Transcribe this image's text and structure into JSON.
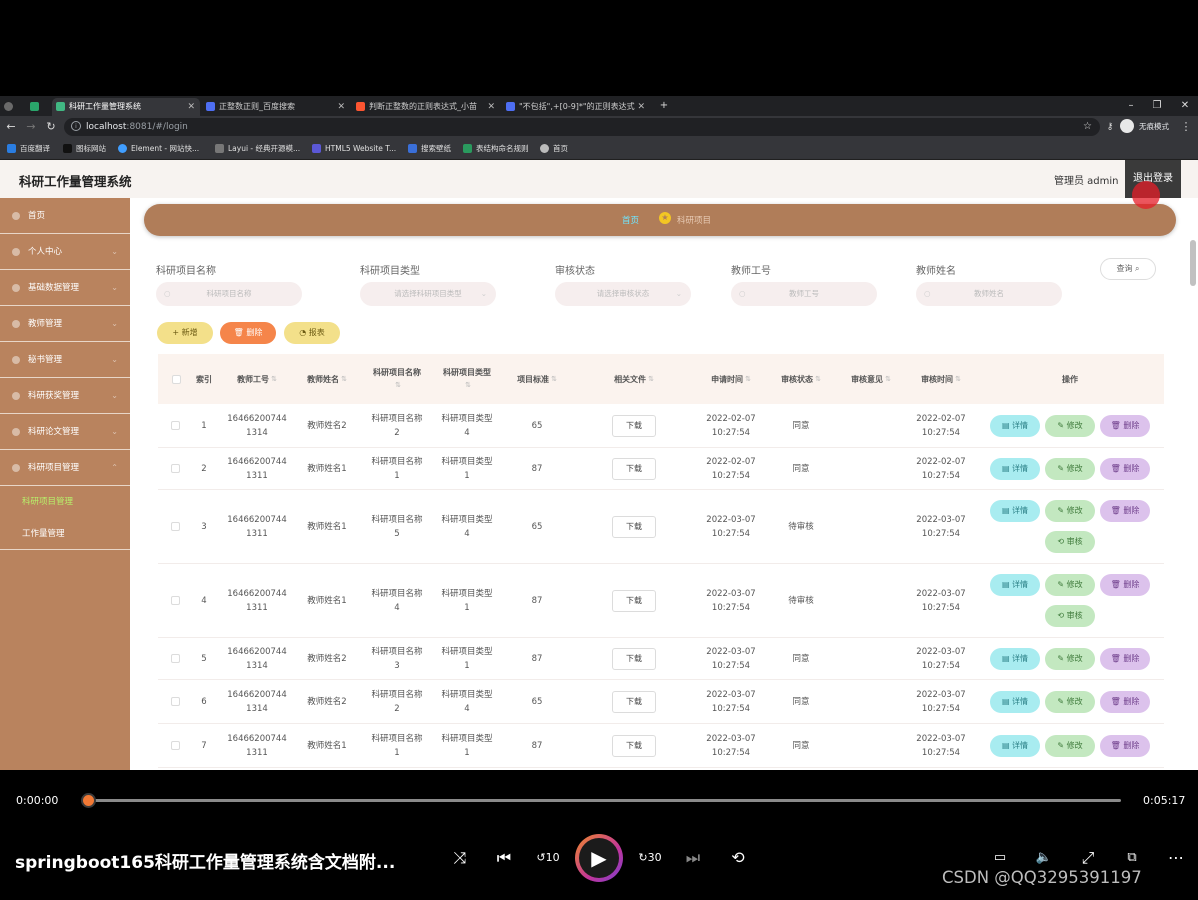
{
  "browser": {
    "tabs": [
      {
        "title": ""
      },
      {
        "title": "科研工作量管理系统"
      },
      {
        "title": "正整数正则_百度搜索"
      },
      {
        "title": "判断正整数的正则表达式_小苗"
      },
      {
        "title": "\"不包括\",+[0-9]*\"的正则表达式"
      }
    ],
    "url": {
      "host": "localhost",
      "rest": ":8081/#/login"
    },
    "profile_label": "无痕模式",
    "bookmarks": [
      "百度翻译",
      "图标网站",
      "Element - 网站快...",
      "Layui - 经典开源模...",
      "HTML5 Website T...",
      "搜索壁纸",
      "表结构命名规则",
      "首页"
    ]
  },
  "app": {
    "title": "科研工作量管理系统",
    "admin_label": "管理员 admin",
    "logout_label": "退出登录",
    "sidebar": {
      "items": [
        {
          "label": "首页"
        },
        {
          "label": "个人中心"
        },
        {
          "label": "基础数据管理"
        },
        {
          "label": "教师管理"
        },
        {
          "label": "秘书管理"
        },
        {
          "label": "科研获奖管理"
        },
        {
          "label": "科研论文管理"
        },
        {
          "label": "科研项目管理"
        }
      ],
      "sub_items": [
        {
          "label": "科研项目管理"
        },
        {
          "label": "工作量管理"
        }
      ]
    },
    "breadcrumb": {
      "home": "首页",
      "current": "科研项目"
    },
    "filters": [
      {
        "label": "科研项目名称",
        "placeholder": "科研项目名称"
      },
      {
        "label": "科研项目类型",
        "placeholder": "请选择科研项目类型"
      },
      {
        "label": "审核状态",
        "placeholder": "请选择审核状态"
      },
      {
        "label": "教师工号",
        "placeholder": "教师工号"
      },
      {
        "label": "教师姓名",
        "placeholder": "教师姓名"
      }
    ],
    "query_label": "查询",
    "actions": {
      "add": "+ 新增",
      "delete": "删除",
      "report": "报表"
    },
    "table": {
      "headers": {
        "index": "索引",
        "teacher_id": "教师工号",
        "teacher_name": "教师姓名",
        "project_name": "科研项目名称",
        "project_type": "科研项目类型",
        "standard": "项目标准",
        "file": "相关文件",
        "apply_time": "申请时间",
        "status": "审核状态",
        "opinion": "审核意见",
        "audit_time": "审核时间",
        "ops": "操作"
      },
      "download_label": "下载",
      "op_labels": {
        "detail": "详情",
        "edit": "修改",
        "delete": "删除",
        "audit": "审核"
      },
      "rows": [
        {
          "index": "1",
          "tid1": "16466200744",
          "tid2": "1314",
          "tname": "教师姓名2",
          "pname1": "科研项目名称",
          "pname2": "2",
          "ptype1": "科研项目类型",
          "ptype2": "4",
          "standard": "65",
          "apply1": "2022-02-07",
          "apply2": "10:27:54",
          "status": "同意",
          "opinion": "",
          "audit1": "2022-02-07",
          "audit2": "10:27:54"
        },
        {
          "index": "2",
          "tid1": "16466200744",
          "tid2": "1311",
          "tname": "教师姓名1",
          "pname1": "科研项目名称",
          "pname2": "1",
          "ptype1": "科研项目类型",
          "ptype2": "1",
          "standard": "87",
          "apply1": "2022-02-07",
          "apply2": "10:27:54",
          "status": "同意",
          "opinion": "",
          "audit1": "2022-02-07",
          "audit2": "10:27:54"
        },
        {
          "index": "3",
          "tid1": "16466200744",
          "tid2": "1311",
          "tname": "教师姓名1",
          "pname1": "科研项目名称",
          "pname2": "5",
          "ptype1": "科研项目类型",
          "ptype2": "4",
          "standard": "65",
          "apply1": "2022-03-07",
          "apply2": "10:27:54",
          "status": "待审核",
          "opinion": "",
          "audit1": "2022-03-07",
          "audit2": "10:27:54"
        },
        {
          "index": "4",
          "tid1": "16466200744",
          "tid2": "1311",
          "tname": "教师姓名1",
          "pname1": "科研项目名称",
          "pname2": "4",
          "ptype1": "科研项目类型",
          "ptype2": "1",
          "standard": "87",
          "apply1": "2022-03-07",
          "apply2": "10:27:54",
          "status": "待审核",
          "opinion": "",
          "audit1": "2022-03-07",
          "audit2": "10:27:54"
        },
        {
          "index": "5",
          "tid1": "16466200744",
          "tid2": "1314",
          "tname": "教师姓名2",
          "pname1": "科研项目名称",
          "pname2": "3",
          "ptype1": "科研项目类型",
          "ptype2": "1",
          "standard": "87",
          "apply1": "2022-03-07",
          "apply2": "10:27:54",
          "status": "同意",
          "opinion": "",
          "audit1": "2022-03-07",
          "audit2": "10:27:54"
        },
        {
          "index": "6",
          "tid1": "16466200744",
          "tid2": "1314",
          "tname": "教师姓名2",
          "pname1": "科研项目名称",
          "pname2": "2",
          "ptype1": "科研项目类型",
          "ptype2": "4",
          "standard": "65",
          "apply1": "2022-03-07",
          "apply2": "10:27:54",
          "status": "同意",
          "opinion": "",
          "audit1": "2022-03-07",
          "audit2": "10:27:54"
        },
        {
          "index": "7",
          "tid1": "16466200744",
          "tid2": "1311",
          "tname": "教师姓名1",
          "pname1": "科研项目名称",
          "pname2": "1",
          "ptype1": "科研项目类型",
          "ptype2": "1",
          "standard": "87",
          "apply1": "2022-03-07",
          "apply2": "10:27:54",
          "status": "同意",
          "opinion": "",
          "audit1": "2022-03-07",
          "audit2": "10:27:54"
        }
      ]
    }
  },
  "player": {
    "current_time": "0:00:00",
    "total_time": "0:05:17",
    "progress": 0,
    "title": "springboot165科研工作量管理系统含文档附...",
    "rewind_label": "10",
    "forward_label": "30",
    "watermark": "CSDN @QQ3295391197"
  },
  "colors": {
    "sidebar": "#b9835e",
    "breadcrumb": "#b07d59",
    "add_button": "#f3e08a",
    "delete_button": "#f5854a",
    "report_button": "#f3e08a",
    "detail_button": "#a8ecf0",
    "edit_button": "#c3e8c0",
    "row_delete_button": "#dcc2ec",
    "progress_thumb": "#f27935"
  }
}
